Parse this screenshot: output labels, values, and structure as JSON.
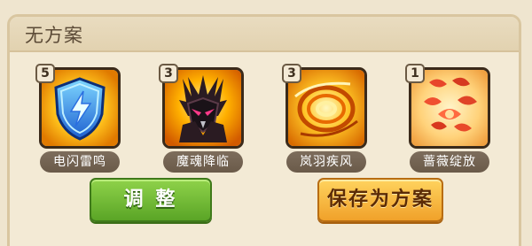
{
  "header": {
    "title": "无方案"
  },
  "skills": [
    {
      "name": "电闪雷鸣",
      "level": "5",
      "icon": "lightning-shield-icon"
    },
    {
      "name": "魔魂降临",
      "level": "3",
      "icon": "demon-mask-icon"
    },
    {
      "name": "岚羽疾风",
      "level": "3",
      "icon": "whirlwind-icon"
    },
    {
      "name": "蔷薇绽放",
      "level": "1",
      "icon": "rose-bloom-icon"
    }
  ],
  "buttons": {
    "adjust": "调 整",
    "save": "保存为方案"
  },
  "colors": {
    "adjust_button": "#6bb832",
    "save_button": "#f5b43a",
    "label_pill": "#75654f"
  }
}
